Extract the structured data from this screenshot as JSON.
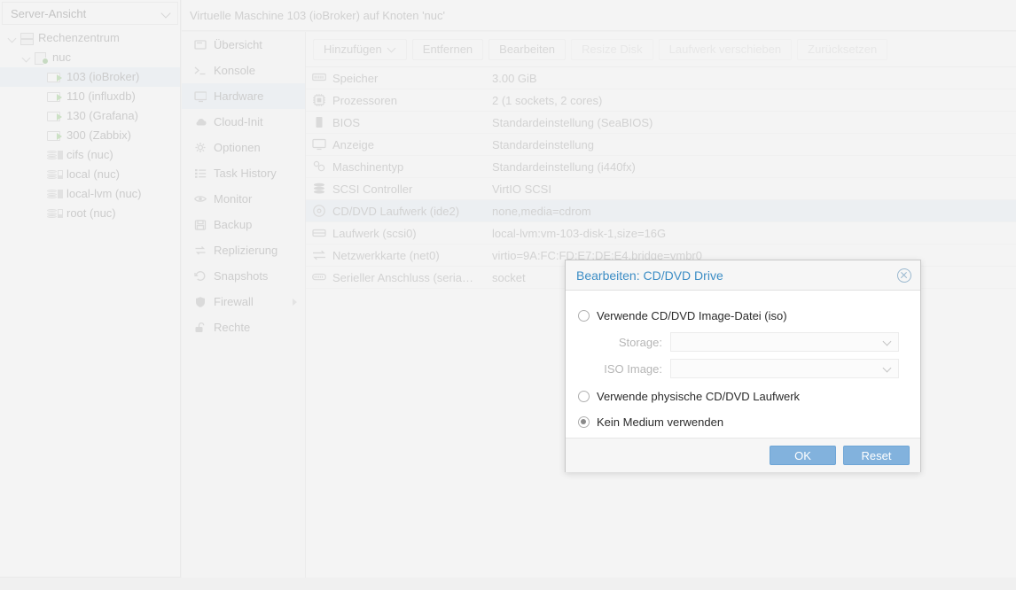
{
  "sidebar": {
    "view_selector": "Server-Ansicht",
    "tree": [
      {
        "label": "Rechenzentrum",
        "icon": "datacenter-icon",
        "indent": 0,
        "arrow": true,
        "selected": false
      },
      {
        "label": "nuc",
        "icon": "node-icon",
        "indent": 1,
        "arrow": true,
        "selected": false
      },
      {
        "label": "103 (ioBroker)",
        "icon": "vm-icon",
        "indent": 2,
        "arrow": false,
        "selected": true
      },
      {
        "label": "110 (influxdb)",
        "icon": "vm-icon",
        "indent": 2,
        "arrow": false,
        "selected": false
      },
      {
        "label": "130 (Grafana)",
        "icon": "vm-icon",
        "indent": 2,
        "arrow": false,
        "selected": false
      },
      {
        "label": "300 (Zabbix)",
        "icon": "vm-icon",
        "indent": 2,
        "arrow": false,
        "selected": false
      },
      {
        "label": "cifs (nuc)",
        "icon": "storage-icon",
        "indent": 2,
        "arrow": false,
        "selected": false
      },
      {
        "label": "local (nuc)",
        "icon": "storage-icon",
        "indent": 2,
        "arrow": false,
        "selected": false
      },
      {
        "label": "local-lvm (nuc)",
        "icon": "storage-icon",
        "indent": 2,
        "arrow": false,
        "selected": false
      },
      {
        "label": "root (nuc)",
        "icon": "storage-icon",
        "indent": 2,
        "arrow": false,
        "selected": false
      }
    ]
  },
  "header": {
    "title": "Virtuelle Maschine 103 (ioBroker) auf Knoten 'nuc'"
  },
  "nav": {
    "items": [
      {
        "label": "Übersicht",
        "icon": "overview-icon",
        "selected": false,
        "submenu": false
      },
      {
        "label": "Konsole",
        "icon": "console-icon",
        "selected": false,
        "submenu": false
      },
      {
        "label": "Hardware",
        "icon": "monitor-icon",
        "selected": true,
        "submenu": false
      },
      {
        "label": "Cloud-Init",
        "icon": "cloud-icon",
        "selected": false,
        "submenu": false
      },
      {
        "label": "Optionen",
        "icon": "gear-icon",
        "selected": false,
        "submenu": false
      },
      {
        "label": "Task History",
        "icon": "list-icon",
        "selected": false,
        "submenu": false
      },
      {
        "label": "Monitor",
        "icon": "eye-icon",
        "selected": false,
        "submenu": false
      },
      {
        "label": "Backup",
        "icon": "floppy-icon",
        "selected": false,
        "submenu": false
      },
      {
        "label": "Replizierung",
        "icon": "replication-icon",
        "selected": false,
        "submenu": false
      },
      {
        "label": "Snapshots",
        "icon": "history-icon",
        "selected": false,
        "submenu": false
      },
      {
        "label": "Firewall",
        "icon": "shield-icon",
        "selected": false,
        "submenu": true
      },
      {
        "label": "Rechte",
        "icon": "unlock-icon",
        "selected": false,
        "submenu": false
      }
    ]
  },
  "toolbar": {
    "buttons": [
      {
        "label": "Hinzufügen",
        "disabled": false,
        "dropdown": true
      },
      {
        "label": "Entfernen",
        "disabled": false,
        "dropdown": false
      },
      {
        "label": "Bearbeiten",
        "disabled": false,
        "dropdown": false
      },
      {
        "label": "Resize Disk",
        "disabled": true,
        "dropdown": false
      },
      {
        "label": "Laufwerk verschieben",
        "disabled": true,
        "dropdown": false
      },
      {
        "label": "Zurücksetzen",
        "disabled": true,
        "dropdown": false
      }
    ]
  },
  "hardware": {
    "rows": [
      {
        "icon": "memory-icon",
        "name": "Speicher",
        "value": "3.00 GiB",
        "selected": false
      },
      {
        "icon": "cpu-icon",
        "name": "Prozessoren",
        "value": "2 (1 sockets, 2 cores)",
        "selected": false
      },
      {
        "icon": "bios-icon",
        "name": "BIOS",
        "value": "Standardeinstellung (SeaBIOS)",
        "selected": false
      },
      {
        "icon": "display-icon",
        "name": "Anzeige",
        "value": "Standardeinstellung",
        "selected": false
      },
      {
        "icon": "machine-icon",
        "name": "Maschinentyp",
        "value": "Standardeinstellung (i440fx)",
        "selected": false
      },
      {
        "icon": "scsi-icon",
        "name": "SCSI Controller",
        "value": "VirtIO SCSI",
        "selected": false
      },
      {
        "icon": "cdrom-icon",
        "name": "CD/DVD Laufwerk (ide2)",
        "value": "none,media=cdrom",
        "selected": true
      },
      {
        "icon": "harddisk-icon",
        "name": "Laufwerk (scsi0)",
        "value": "local-lvm:vm-103-disk-1,size=16G",
        "selected": false
      },
      {
        "icon": "network-icon",
        "name": "Netzwerkkarte (net0)",
        "value": "virtio=9A:FC:FD:E7:DE:E4,bridge=vmbr0",
        "selected": false
      },
      {
        "icon": "serial-icon",
        "name": "Serieller Anschluss (seria…",
        "value": "socket",
        "selected": false
      }
    ]
  },
  "dialog": {
    "title": "Bearbeiten: CD/DVD Drive",
    "close_label": "",
    "options": [
      {
        "label": "Verwende CD/DVD Image-Datei (iso)",
        "selected": false
      },
      {
        "label": "Verwende physische CD/DVD Laufwerk",
        "selected": false
      },
      {
        "label": "Kein Medium verwenden",
        "selected": true
      }
    ],
    "fields": [
      {
        "label": "Storage:",
        "value": "",
        "disabled": true
      },
      {
        "label": "ISO Image:",
        "value": "",
        "disabled": true
      }
    ],
    "ok_label": "OK",
    "reset_label": "Reset"
  },
  "colors": {
    "accent": "#3c8dc5",
    "selection": "#e4eef8",
    "button": "#82b2dd",
    "running": "#6aab5b"
  }
}
